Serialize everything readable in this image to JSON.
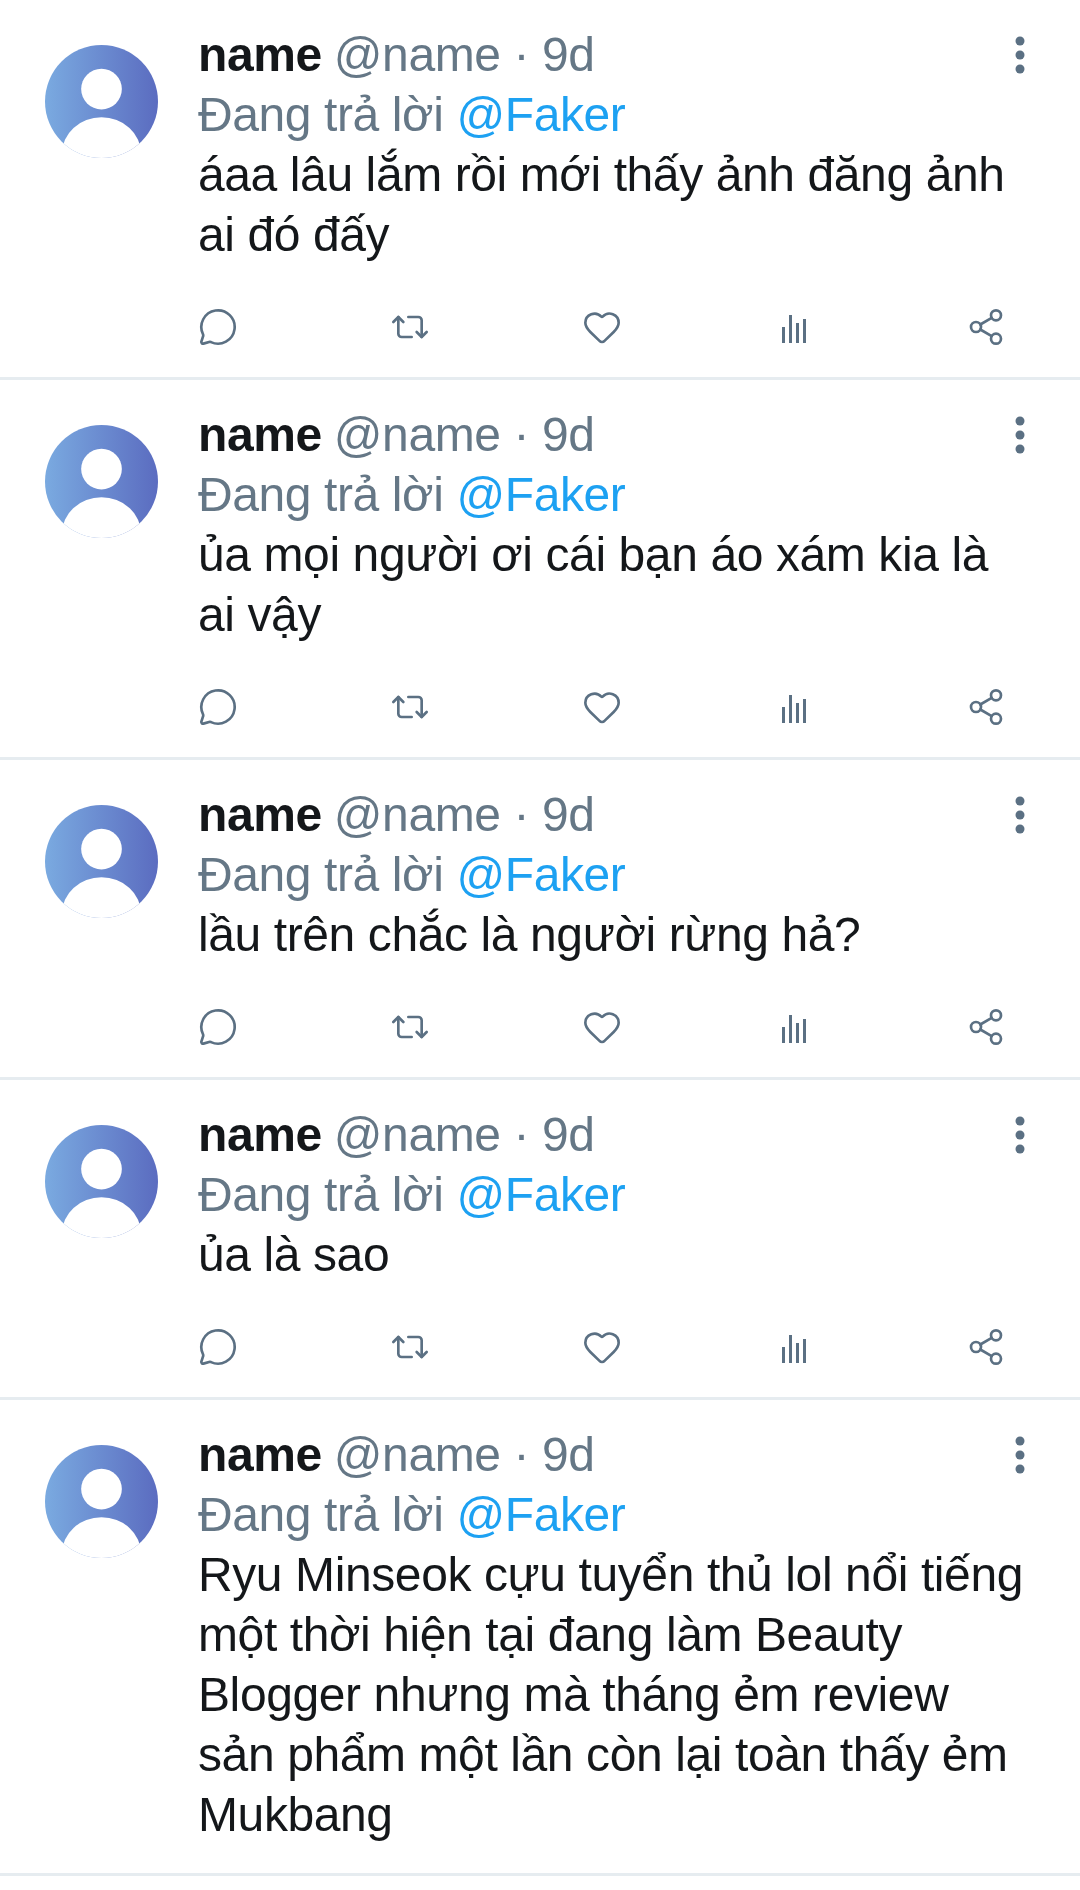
{
  "tweets": [
    {
      "name": "name",
      "meta": "@name · 9d",
      "reply_prefix": "Đang trả lời",
      "reply_to": "@Faker",
      "text": "áaa lâu lắm rồi mới thấy ảnh đăng ảnh ai đó đấy",
      "actions_visible": true
    },
    {
      "name": "name",
      "meta": "@name · 9d",
      "reply_prefix": "Đang trả lời",
      "reply_to": "@Faker",
      "text": "ủa mọi người ơi cái bạn áo xám kia là ai vậy",
      "actions_visible": true
    },
    {
      "name": "name",
      "meta": "@name · 9d",
      "reply_prefix": "Đang trả lời",
      "reply_to": "@Faker",
      "text": "lầu trên chắc là người rừng hả?",
      "actions_visible": true
    },
    {
      "name": "name",
      "meta": "@name · 9d",
      "reply_prefix": "Đang trả lời",
      "reply_to": "@Faker",
      "text": "ủa là sao",
      "actions_visible": true
    },
    {
      "name": "name",
      "meta": "@name · 9d",
      "reply_prefix": "Đang trả lời",
      "reply_to": "@Faker",
      "text": "Ryu Minseok cựu tuyển thủ lol nổi tiếng một thời hiện tại đang làm Beauty Blogger nhưng mà tháng ẻm review sản phẩm một lần còn lại toàn thấy ẻm Mukbang",
      "actions_visible": false
    }
  ]
}
